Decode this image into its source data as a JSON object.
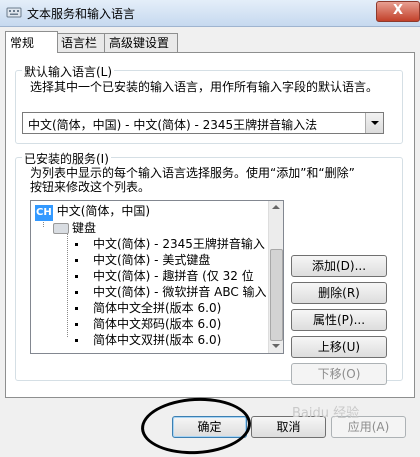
{
  "window": {
    "title": "文本服务和输入语言",
    "close_label": "X"
  },
  "tabs": [
    {
      "label": "常规"
    },
    {
      "label": "语言栏"
    },
    {
      "label": "高级键设置"
    }
  ],
  "default_language": {
    "group_label": "默认输入语言(L)",
    "description": "选择其中一个已安装的输入语言，用作所有输入字段的默认语言。",
    "selected": "中文(简体，中国) - 中文(简体) - 2345王牌拼音输入法"
  },
  "installed_services": {
    "group_label": "已安装的服务(I)",
    "description_line1": "为列表中显示的每个输入语言选择服务。使用“添加”和“删除”",
    "description_line2": "按钮来修改这个列表。",
    "language_icon": "CH",
    "language_label": "中文(简体，中国)",
    "keyboard_label": "键盘",
    "items": [
      "中文(简体) - 2345王牌拼音输入",
      "中文(简体) - 美式键盘",
      "中文(简体) - 趣拼音 (仅 32 位",
      "中文(简体) - 微软拼音 ABC 输入",
      "简体中文全拼(版本 6.0)",
      "简体中文郑码(版本 6.0)",
      "简体中文双拼(版本 6.0)"
    ]
  },
  "side_buttons": {
    "add": "添加(D)...",
    "remove": "删除(R)",
    "properties": "属性(P)...",
    "move_up": "上移(U)",
    "move_down": "下移(O)"
  },
  "dialog_buttons": {
    "ok": "确定",
    "cancel": "取消",
    "apply": "应用(A)"
  },
  "watermark": "Baidu 经验"
}
